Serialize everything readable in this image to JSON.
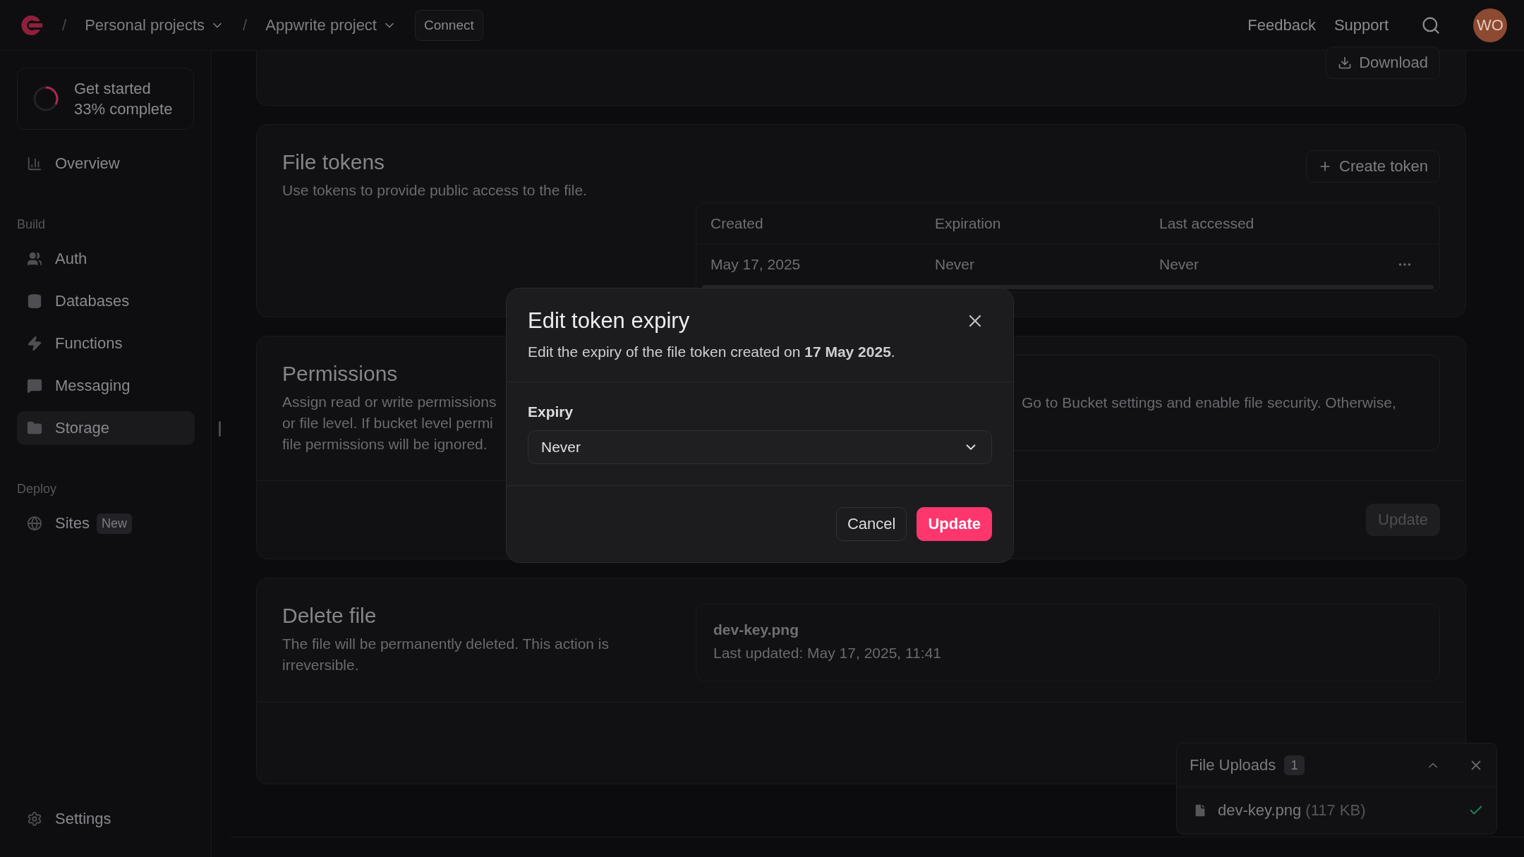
{
  "topbar": {
    "breadcrumbs": [
      {
        "separator": "/",
        "label": "Personal projects"
      },
      {
        "separator": "/",
        "label": "Appwrite project"
      }
    ],
    "connect_button": "Connect",
    "links": [
      "Feedback",
      "Support"
    ],
    "avatar": "WO"
  },
  "sidebar": {
    "progress": {
      "title": "Get started",
      "subtitle": "33% complete",
      "level": 0.33
    },
    "sections": [
      {
        "items": [
          {
            "label": "Overview",
            "selected": false
          }
        ]
      },
      {
        "heading": "Build",
        "items": [
          {
            "label": "Auth",
            "selected": false
          },
          {
            "label": "Databases",
            "selected": false
          },
          {
            "label": "Functions",
            "selected": false
          },
          {
            "label": "Messaging",
            "selected": false
          },
          {
            "label": "Storage",
            "selected": true
          }
        ]
      },
      {
        "heading": "Deploy",
        "items": [
          {
            "label": "Sites",
            "badge": "New",
            "selected": false
          }
        ]
      }
    ],
    "footer_item": {
      "label": "Settings"
    }
  },
  "download_button": "Download",
  "file_tokens": {
    "title": "File tokens",
    "description": "Use tokens to provide public access to the file.",
    "create_button": "Create token",
    "columns": [
      "Created",
      "Expiration",
      "Last accessed"
    ],
    "rows": [
      {
        "cells": [
          "May 17, 2025",
          "Never",
          "Never"
        ]
      }
    ]
  },
  "permissions": {
    "title": "Permissions",
    "description": "Assign read or write permissions\nor file level. If bucket level permi\nfile permissions will be ignored.",
    "notice": "Go to Bucket settings and enable file security. Otherwise,",
    "update_button": "Update",
    "update_disabled": true
  },
  "delete_file": {
    "title": "Delete file",
    "description": "The file will be permanently deleted. This action is irreversible.",
    "file_name": "dev-key.png",
    "updated": "Last updated: May 17, 2025, 11:41"
  },
  "dialog": {
    "title": "Edit token expiry",
    "description": "Edit the expiry of the file token created on **17 May 2025**.",
    "field_label": "Expiry",
    "select_value": "Never",
    "buttons": [
      {
        "label": "Cancel",
        "kind": "secondary"
      },
      {
        "label": "Update",
        "kind": "primary"
      }
    ]
  },
  "uploads": {
    "title": "File Uploads",
    "count": "1",
    "files": [
      {
        "name": "dev-key.png",
        "size": "(117 KB)",
        "done": true
      }
    ]
  }
}
